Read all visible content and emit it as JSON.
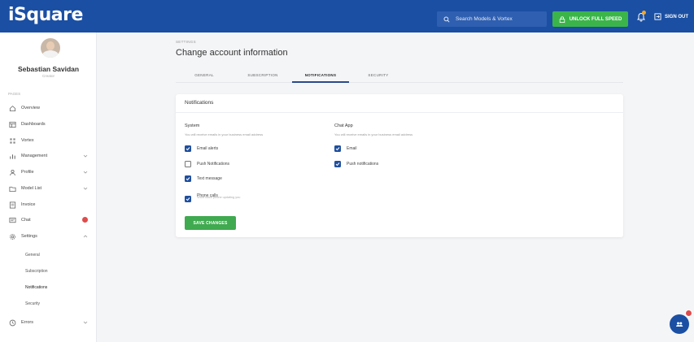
{
  "app": {
    "logo": "iSquare"
  },
  "topbar": {
    "search_placeholder": "Search Models & Vortex",
    "unlock_label": "UNLOCK FULL SPEED",
    "signout_label": "SIGN OUT"
  },
  "user": {
    "name": "Sebastian Savidan",
    "role": "Creator"
  },
  "sidebar": {
    "section_label": "PAGES",
    "items": [
      {
        "label": "Overview",
        "icon": "home-icon",
        "chevron": false
      },
      {
        "label": "Dashboards",
        "icon": "dashboard-icon",
        "chevron": false
      },
      {
        "label": "Vortex",
        "icon": "grid-icon",
        "chevron": false
      },
      {
        "label": "Management",
        "icon": "analytics-icon",
        "chevron": true
      },
      {
        "label": "Profile",
        "icon": "user-icon",
        "chevron": true
      },
      {
        "label": "Model List",
        "icon": "folder-icon",
        "chevron": true
      },
      {
        "label": "Invoice",
        "icon": "invoice-icon",
        "chevron": false
      },
      {
        "label": "Chat",
        "icon": "chat-icon",
        "chevron": false
      },
      {
        "label": "Settings",
        "icon": "gear-icon",
        "chevron": true
      }
    ],
    "settings_sub": [
      "General",
      "Subscription",
      "Notifications",
      "Security"
    ],
    "errors_label": "Errors"
  },
  "main": {
    "breadcrumb": "SETTINGS",
    "title": "Change account information",
    "tabs": [
      "GENERAL",
      "SUBSCRIPTION",
      "NOTIFICATIONS",
      "SECURITY"
    ],
    "active_tab": "NOTIFICATIONS"
  },
  "notifications": {
    "card_title": "Notifications",
    "system": {
      "title": "System",
      "desc": "You will receive emails in your business email address",
      "options": [
        {
          "label": "Email alerts",
          "checked": true
        },
        {
          "label": "Push Notifications",
          "checked": false
        },
        {
          "label": "Text message",
          "checked": true
        },
        {
          "label": "Phone calls",
          "checked": true,
          "sub": "Short voice phone updating you"
        }
      ]
    },
    "chat_app": {
      "title": "Chat App",
      "desc": "You will receive emails in your business email address",
      "options": [
        {
          "label": "Email",
          "checked": true
        },
        {
          "label": "Push notifications",
          "checked": true
        }
      ]
    },
    "save_label": "SAVE CHANGES"
  },
  "colors": {
    "primary": "#1a4fa3",
    "success": "#3bb54a",
    "danger": "#e04b4b"
  }
}
